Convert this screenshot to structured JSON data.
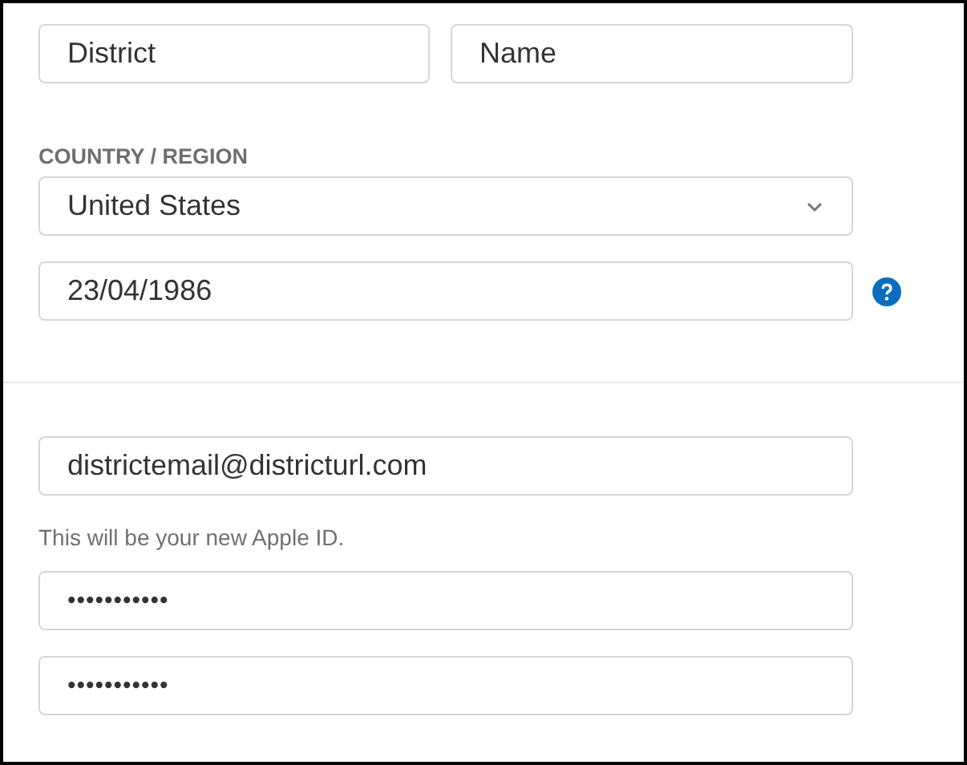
{
  "name_fields": [
    {
      "value": "District"
    },
    {
      "value": "Name"
    }
  ],
  "country": {
    "label": "COUNTRY / REGION",
    "value": "United States"
  },
  "birthday": {
    "value": "23/04/1986"
  },
  "email": {
    "value": "districtemail@districturl.com",
    "hint": "This will be your new Apple ID."
  },
  "passwords": [
    {
      "value": "•••••••••••"
    },
    {
      "value": "•••••••••••"
    }
  ]
}
